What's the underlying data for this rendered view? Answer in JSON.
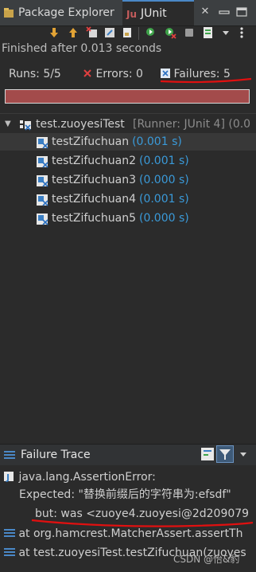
{
  "tabs": {
    "package_explorer": "Package Explorer",
    "junit": "JUnit",
    "close": "✕"
  },
  "status": "Finished after 0.013 seconds",
  "counts": {
    "runs_label": "Runs:",
    "runs_value": "5/5",
    "errors_label": "Errors:",
    "errors_value": "0",
    "failures_label": "Failures:",
    "failures_value": "5"
  },
  "progress": {
    "fraction": 1.0,
    "color": "#a34b4b"
  },
  "tree": {
    "suite_name": "test.zuoyesiTest",
    "suite_runner": "[Runner: JUnit 4] (0.0",
    "tests": [
      {
        "name": "testZifuchuan",
        "time": "(0.001 s)"
      },
      {
        "name": "testZifuchuan2",
        "time": "(0.001 s)"
      },
      {
        "name": "testZifuchuan3",
        "time": "(0.000 s)"
      },
      {
        "name": "testZifuchuan4",
        "time": "(0.001 s)"
      },
      {
        "name": "testZifuchuan5",
        "time": "(0.000 s)"
      }
    ]
  },
  "failure_trace": {
    "title": "Failure Trace",
    "lines": [
      "java.lang.AssertionError:",
      "Expected: \"替换前缀后的字符串为:efsdf\"",
      "but: was <zuoye4.zuoyesi@2d209079",
      "at org.hamcrest.MatcherAssert.assertTh",
      "at test.zuoyesiTest.testZifuchuan(zuoyes"
    ]
  },
  "watermark": "CSDN @怡&豹",
  "colors": {
    "accent": "#4a88c7",
    "failure_bar": "#a34b4b",
    "time": "#3a9ad9",
    "annotation": "#e01010"
  }
}
